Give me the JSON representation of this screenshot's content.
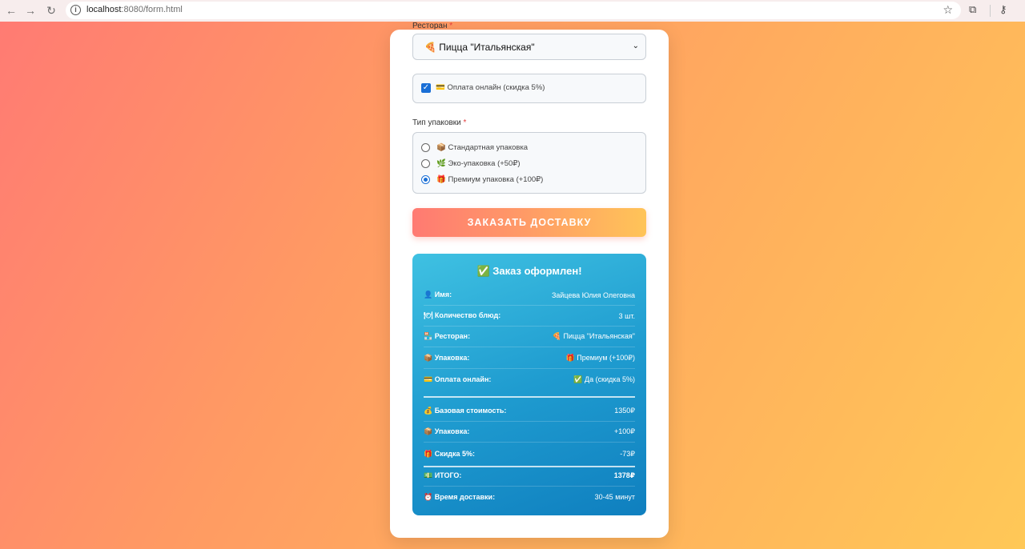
{
  "browser": {
    "back": "←",
    "forward": "→",
    "reload": "↻",
    "info": "i",
    "url_host": "localhost",
    "url_path": ":8080/form.html",
    "star": "☆",
    "extensions": "⧉",
    "key": "⚷"
  },
  "form": {
    "restaurant_label": "Ресторан",
    "required_mark": "*",
    "restaurant_value": "🍕 Пицца \"Итальянская\"",
    "chevron": "⌄",
    "online_payment_checked": true,
    "online_payment_label": "💳 Оплата онлайн (скидка 5%)",
    "packaging_label": "Тип упаковки",
    "packaging_options": [
      {
        "label": "📦 Стандартная упаковка",
        "checked": false
      },
      {
        "label": "🌿 Эко-упаковка (+50₽)",
        "checked": false
      },
      {
        "label": "🎁 Премиум упаковка (+100₽)",
        "checked": true
      }
    ],
    "submit_label": "ЗАКАЗАТЬ ДОСТАВКУ"
  },
  "summary": {
    "title": "✅ Заказ оформлен!",
    "rows": [
      {
        "key": "👤 Имя:",
        "value": "Зайцева Юлия Олеговна"
      },
      {
        "key": "🍽 Количество блюд:",
        "value": "3 шт."
      },
      {
        "key": "🏪 Ресторан:",
        "value": "🍕 Пицца \"Итальянская\""
      },
      {
        "key": "📦 Упаковка:",
        "value": "🎁 Премиум (+100₽)"
      },
      {
        "key": "💳 Оплата онлайн:",
        "value": "✅ Да (скидка 5%)"
      }
    ],
    "cost_rows": [
      {
        "key": "💰 Базовая стоимость:",
        "value": "1350₽"
      },
      {
        "key": "📦 Упаковка:",
        "value": "+100₽"
      },
      {
        "key": "🎁 Скидка 5%:",
        "value": "-73₽"
      }
    ],
    "total": {
      "key": "💵 ИТОГО:",
      "value": "1378₽"
    },
    "delivery": {
      "key": "⏰ Время доставки:",
      "value": "30-45 минут"
    }
  }
}
